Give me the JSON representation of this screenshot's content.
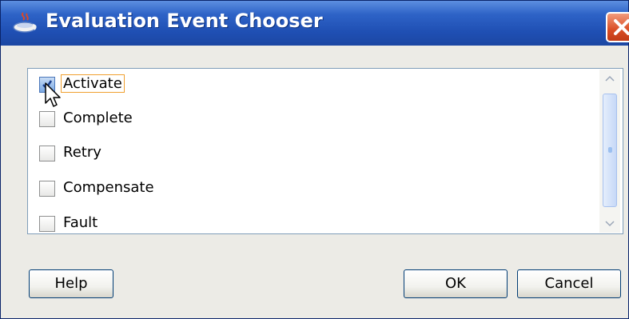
{
  "window": {
    "title": "Evaluation Event Chooser",
    "app_icon": "java-cup-icon",
    "close_icon": "close-icon"
  },
  "events": [
    {
      "label": "Activate",
      "checked": true,
      "focused": true
    },
    {
      "label": "Complete",
      "checked": false
    },
    {
      "label": "Retry",
      "checked": false
    },
    {
      "label": "Compensate",
      "checked": false
    },
    {
      "label": "Fault",
      "checked": false
    }
  ],
  "buttons": {
    "help": "Help",
    "ok": "OK",
    "cancel": "Cancel"
  },
  "colors": {
    "titlebar": "#2e63c7",
    "close_button": "#d94d25",
    "focus_outline": "#f0a030"
  }
}
